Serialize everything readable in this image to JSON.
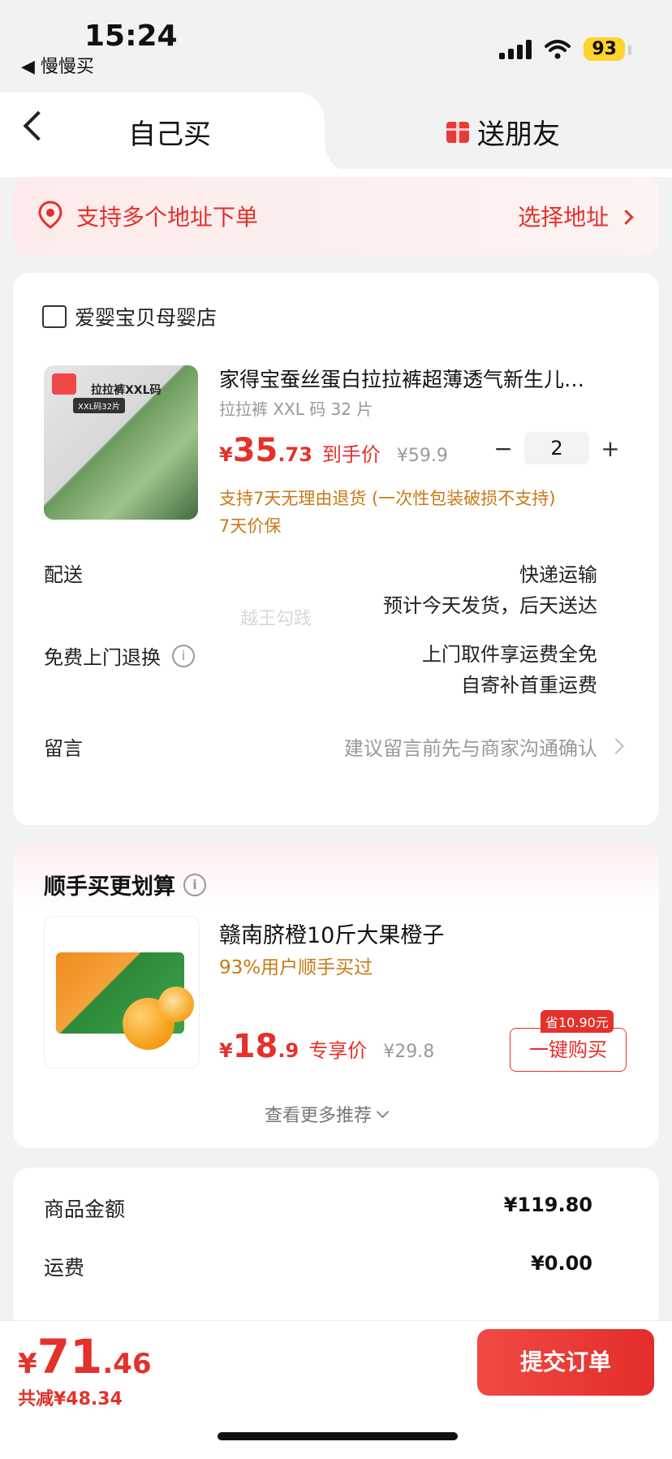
{
  "status_bar": {
    "time": "15:24",
    "back_app": "◀ 慢慢买",
    "battery": "93"
  },
  "tabs": {
    "self": "自己买",
    "friend": "送朋友"
  },
  "address": {
    "text": "支持多个地址下单",
    "select": "选择地址"
  },
  "store": {
    "name": "爱婴宝贝母婴店"
  },
  "product": {
    "title": "家得宝蚕丝蛋白拉拉裤超薄透气新生儿…",
    "spec": "拉拉裤 XXL 码 32 片",
    "price_yen": "¥",
    "price_int": "35",
    "price_dec": ".73",
    "price_tag": "到手价",
    "price_orig": "¥59.9",
    "quantity": "2",
    "minus": "−",
    "plus": "+",
    "image_label": "拉拉裤XXL码",
    "image_sub": "XXL码32片",
    "promise_1": "支持7天无理由退货 (一次性包装破损不支持)",
    "promise_2": "7天价保"
  },
  "delivery": {
    "label": "配送",
    "line1": "快递运输",
    "line2": "预计今天发货，后天送达"
  },
  "return": {
    "label": "免费上门退换",
    "info": "i",
    "line1": "上门取件享运费全免",
    "line2": "自寄补首重运费"
  },
  "message": {
    "label": "留言",
    "placeholder": "建议留言前先与商家沟通确认"
  },
  "watermark": "越王勾践",
  "recommend": {
    "title": "顺手买更划算",
    "info": "i",
    "name": "赣南脐橙10斤大果橙子",
    "sub": "93%用户顺手买过",
    "price_yen": "¥",
    "price_int": "18",
    "price_dec": ".9",
    "price_tag": "专享价",
    "price_orig": "¥29.8",
    "save_badge": "省10.90元",
    "buy": "一键购买",
    "more": "查看更多推荐"
  },
  "totals": {
    "goods_label": "商品金额",
    "goods_value": "¥119.80",
    "shipping_label": "运费",
    "shipping_value": "¥0.00"
  },
  "bottom": {
    "yen": "¥",
    "int": "71",
    "dec": ".46",
    "discount": "共减¥48.34",
    "submit": "提交订单"
  },
  "colors": {
    "accent": "#e3322b",
    "promise": "#c77a15",
    "background": "#f2f2f2"
  }
}
